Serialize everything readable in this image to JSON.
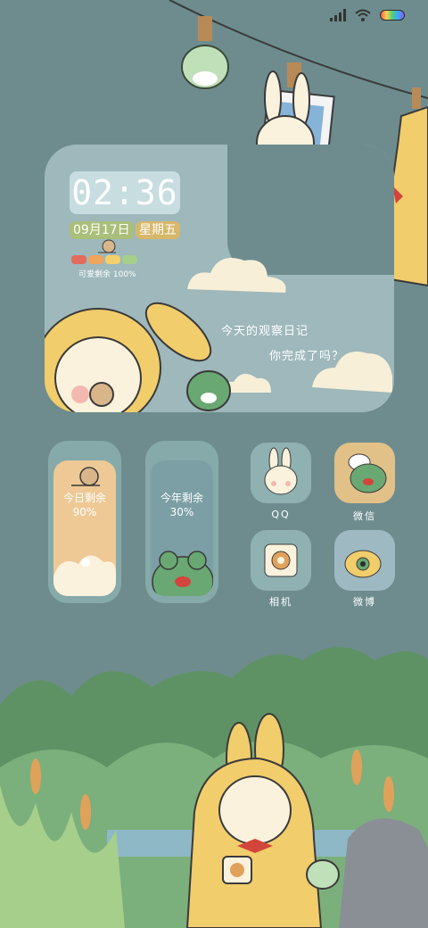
{
  "status_bar": {
    "signal_icon": "signal-icon",
    "wifi_icon": "wifi-icon",
    "battery_icon": "battery-icon"
  },
  "clock_widget": {
    "time": "02:36",
    "date": "09月17日",
    "weekday": "星期五",
    "battery_text": "可爱剩余 100%",
    "battery_level": 1.0,
    "caption_line1": "今天的观察日记",
    "caption_line2": "你完成了吗？"
  },
  "progress_widgets": [
    {
      "label": "今日剩余",
      "value": "90%"
    },
    {
      "label": "今年剩余",
      "value": "30%"
    }
  ],
  "apps": [
    {
      "label": "QQ",
      "icon": "bunny-qq-icon",
      "bg": "#8fb1b1"
    },
    {
      "label": "微信",
      "icon": "frog-wechat-icon",
      "bg": "#e2c189"
    },
    {
      "label": "相机",
      "icon": "camera-icon",
      "bg": "#8fb1b1"
    },
    {
      "label": "微博",
      "icon": "eye-weibo-icon",
      "bg": "#9fb9c2"
    }
  ],
  "colors": {
    "background": "#6e8c8e",
    "widget": "#9eb8bb",
    "accent_yellow": "#f1d27a",
    "accent_green": "#5f9b6a"
  }
}
